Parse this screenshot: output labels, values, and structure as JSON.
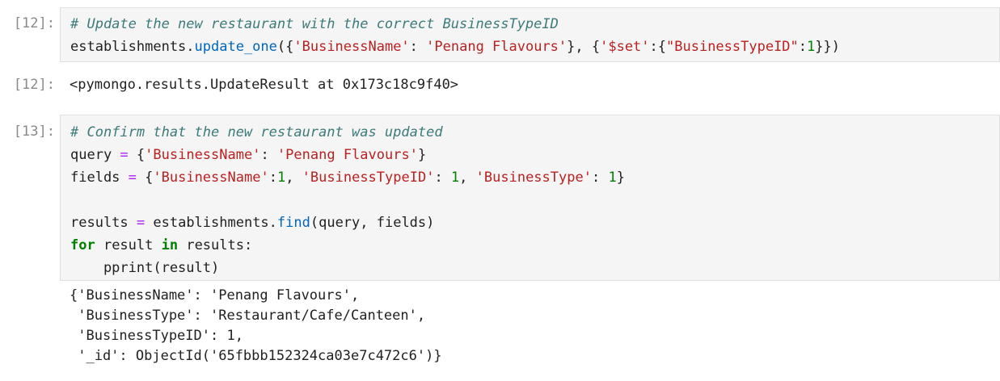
{
  "cells": [
    {
      "type": "input",
      "prompt": "[12]:",
      "lines": [
        [
          {
            "t": "# Update the new restaurant with the correct BusinessTypeID",
            "c": "cm"
          }
        ],
        [
          {
            "t": "establishments.",
            "c": "bk"
          },
          {
            "t": "update_one",
            "c": "fn"
          },
          {
            "t": "({",
            "c": "bk"
          },
          {
            "t": "'BusinessName'",
            "c": "st"
          },
          {
            "t": ": ",
            "c": "bk"
          },
          {
            "t": "'Penang Flavours'",
            "c": "st"
          },
          {
            "t": "}, {",
            "c": "bk"
          },
          {
            "t": "'$set'",
            "c": "st"
          },
          {
            "t": ":{",
            "c": "bk"
          },
          {
            "t": "\"BusinessTypeID\"",
            "c": "st"
          },
          {
            "t": ":",
            "c": "bk"
          },
          {
            "t": "1",
            "c": "nm"
          },
          {
            "t": "}})",
            "c": "bk"
          }
        ]
      ]
    },
    {
      "type": "output",
      "prompt": "[12]:",
      "lines": [
        [
          {
            "t": "<pymongo.results.UpdateResult at 0x173c18c9f40>",
            "c": "bk"
          }
        ]
      ]
    },
    {
      "type": "input",
      "prompt": "[13]:",
      "lines": [
        [
          {
            "t": "# Confirm that the new restaurant was updated",
            "c": "cm"
          }
        ],
        [
          {
            "t": "query ",
            "c": "bk"
          },
          {
            "t": "=",
            "c": "op"
          },
          {
            "t": " {",
            "c": "bk"
          },
          {
            "t": "'BusinessName'",
            "c": "st"
          },
          {
            "t": ": ",
            "c": "bk"
          },
          {
            "t": "'Penang Flavours'",
            "c": "st"
          },
          {
            "t": "}",
            "c": "bk"
          }
        ],
        [
          {
            "t": "fields ",
            "c": "bk"
          },
          {
            "t": "=",
            "c": "op"
          },
          {
            "t": " {",
            "c": "bk"
          },
          {
            "t": "'BusinessName'",
            "c": "st"
          },
          {
            "t": ":",
            "c": "bk"
          },
          {
            "t": "1",
            "c": "nm"
          },
          {
            "t": ", ",
            "c": "bk"
          },
          {
            "t": "'BusinessTypeID'",
            "c": "st"
          },
          {
            "t": ": ",
            "c": "bk"
          },
          {
            "t": "1",
            "c": "nm"
          },
          {
            "t": ", ",
            "c": "bk"
          },
          {
            "t": "'BusinessType'",
            "c": "st"
          },
          {
            "t": ": ",
            "c": "bk"
          },
          {
            "t": "1",
            "c": "nm"
          },
          {
            "t": "}",
            "c": "bk"
          }
        ],
        [
          {
            "t": "",
            "c": "bk"
          }
        ],
        [
          {
            "t": "results ",
            "c": "bk"
          },
          {
            "t": "=",
            "c": "op"
          },
          {
            "t": " establishments.",
            "c": "bk"
          },
          {
            "t": "find",
            "c": "fn"
          },
          {
            "t": "(query, fields)",
            "c": "bk"
          }
        ],
        [
          {
            "t": "for",
            "c": "kw"
          },
          {
            "t": " result ",
            "c": "bk"
          },
          {
            "t": "in",
            "c": "kw"
          },
          {
            "t": " results:",
            "c": "bk"
          }
        ],
        [
          {
            "t": "    pprint(result)",
            "c": "bk"
          }
        ]
      ]
    },
    {
      "type": "stream",
      "prompt": "",
      "lines": [
        [
          {
            "t": "{'BusinessName': 'Penang Flavours',",
            "c": "bk"
          }
        ],
        [
          {
            "t": " 'BusinessType': 'Restaurant/Cafe/Canteen',",
            "c": "bk"
          }
        ],
        [
          {
            "t": " 'BusinessTypeID': 1,",
            "c": "bk"
          }
        ],
        [
          {
            "t": " '_id': ObjectId('65fbbb152324ca03e7c472c6')}",
            "c": "bk"
          }
        ]
      ]
    }
  ]
}
